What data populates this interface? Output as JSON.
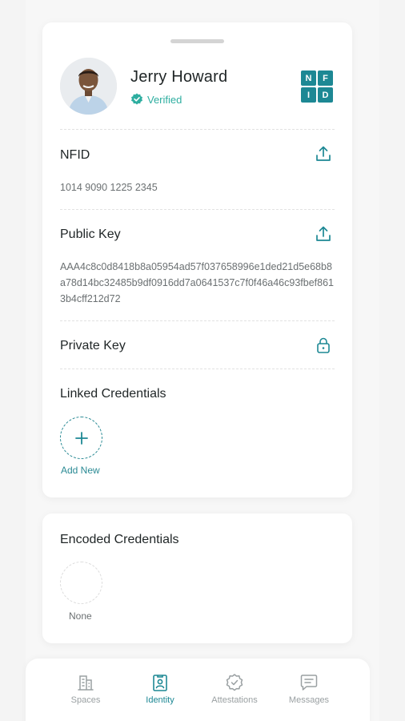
{
  "profile": {
    "name": "Jerry Howard",
    "status": "Verified",
    "logo_letters": [
      "N",
      "F",
      "I",
      "D"
    ]
  },
  "nfid": {
    "label": "NFID",
    "value": "1014 9090 1225 2345"
  },
  "public_key": {
    "label": "Public Key",
    "value": "AAA4c8c0d8418b8a05954ad57f037658996e1ded21d5e68b8a78d14bc32485b9df0916dd7a0641537c7f0f46a46c93fbef8613b4cff212d72"
  },
  "private_key": {
    "label": "Private Key"
  },
  "linked_credentials": {
    "label": "Linked Credentials",
    "add_label": "Add New"
  },
  "encoded_credentials": {
    "label": "Encoded Credentials",
    "empty_label": "None"
  },
  "tabbar": {
    "tabs": [
      {
        "label": "Spaces",
        "icon": "building-icon",
        "active": false
      },
      {
        "label": "Identity",
        "icon": "id-badge-icon",
        "active": true
      },
      {
        "label": "Attestations",
        "icon": "badge-check-icon",
        "active": false
      },
      {
        "label": "Messages",
        "icon": "message-icon",
        "active": false
      }
    ]
  },
  "colors": {
    "accent": "#1d8894",
    "verified": "#2eaea0",
    "muted": "#9aa0a2"
  }
}
